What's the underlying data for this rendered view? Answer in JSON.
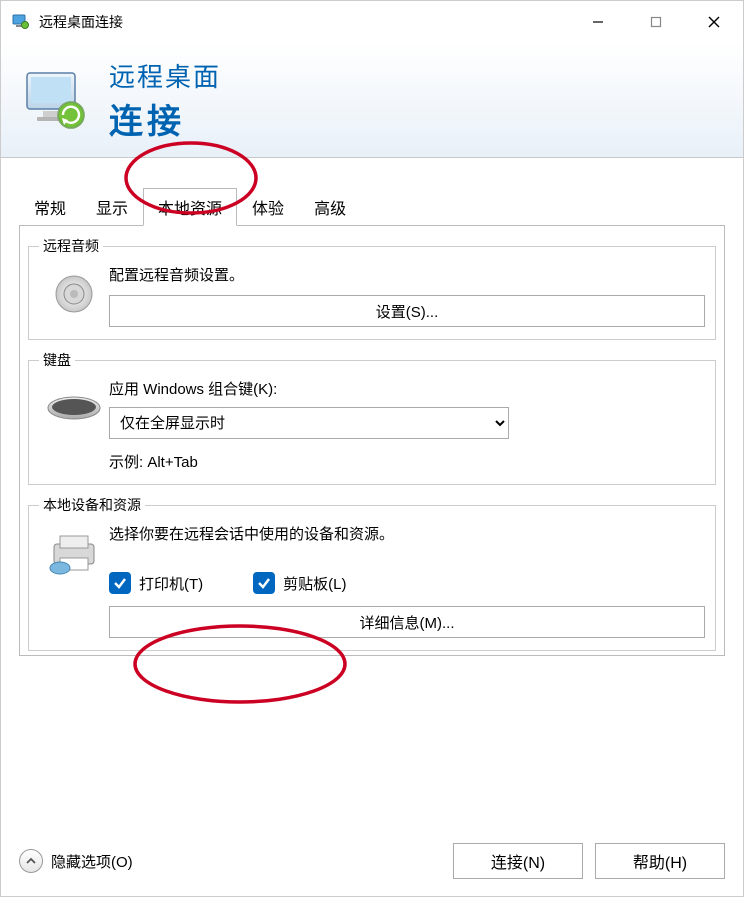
{
  "titlebar": {
    "title": "远程桌面连接"
  },
  "header": {
    "line1": "远程桌面",
    "line2": "连接"
  },
  "tabs": {
    "items": [
      {
        "label": "常规"
      },
      {
        "label": "显示"
      },
      {
        "label": "本地资源"
      },
      {
        "label": "体验"
      },
      {
        "label": "高级"
      }
    ],
    "active_index": 2
  },
  "audio": {
    "legend": "远程音频",
    "text": "配置远程音频设置。",
    "settings_btn": "设置(S)..."
  },
  "keyboard": {
    "legend": "键盘",
    "label": "应用 Windows 组合键(K):",
    "selected": "仅在全屏显示时",
    "example": "示例: Alt+Tab"
  },
  "devices": {
    "legend": "本地设备和资源",
    "text": "选择你要在远程会话中使用的设备和资源。",
    "printer_label": "打印机(T)",
    "clipboard_label": "剪贴板(L)",
    "more_btn": "详细信息(M)..."
  },
  "footer": {
    "hide_options": "隐藏选项(O)",
    "connect": "连接(N)",
    "help": "帮助(H)"
  }
}
